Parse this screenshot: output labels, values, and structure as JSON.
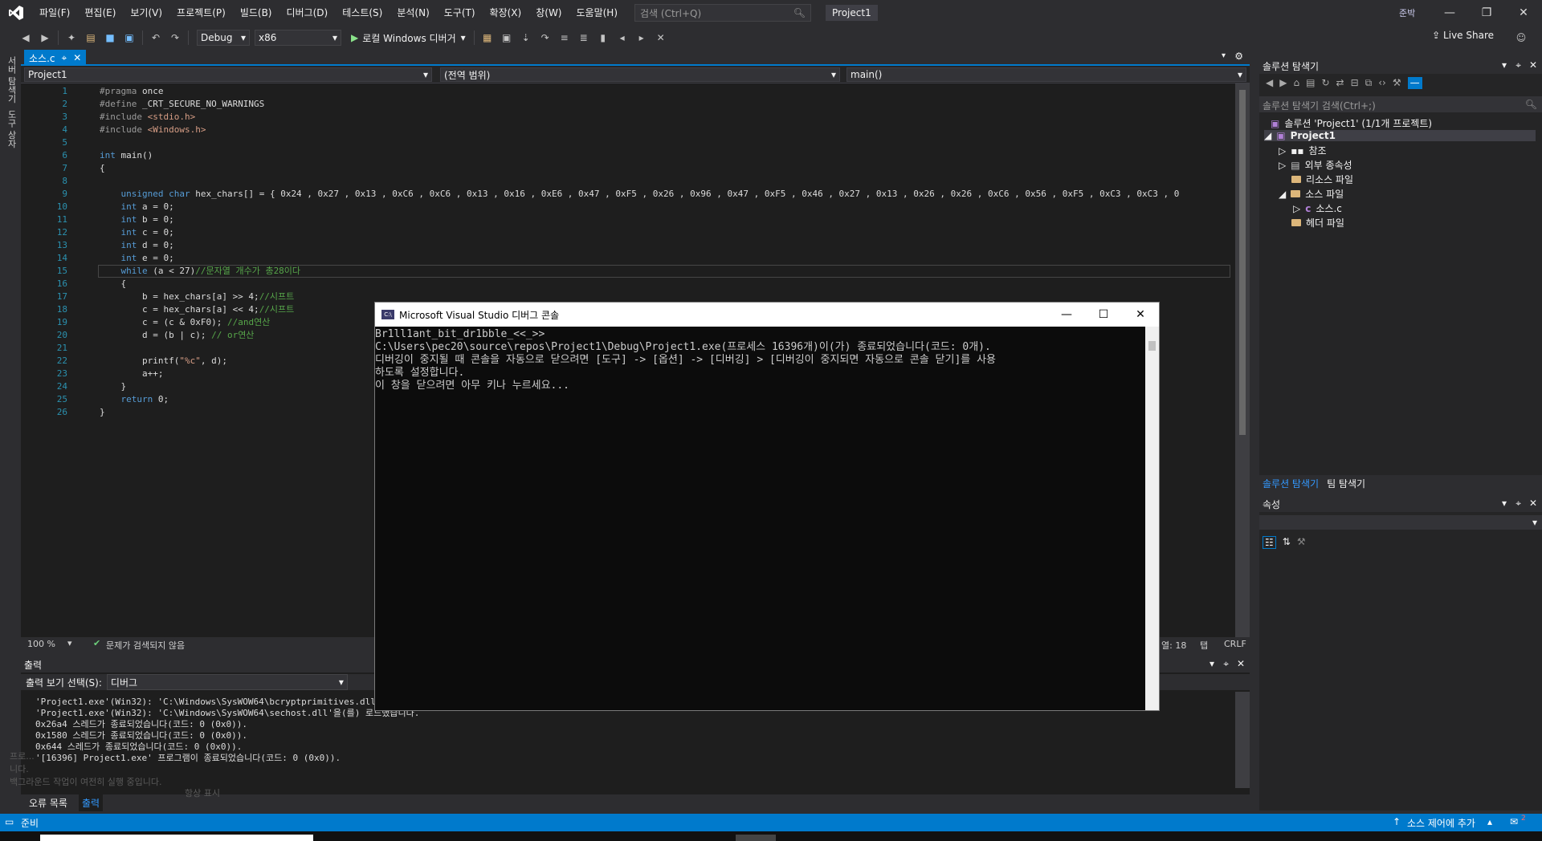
{
  "menubar": {
    "items": [
      "파일(F)",
      "편집(E)",
      "보기(V)",
      "프로젝트(P)",
      "빌드(B)",
      "디버그(D)",
      "테스트(S)",
      "분석(N)",
      "도구(T)",
      "확장(X)",
      "창(W)",
      "도움말(H)"
    ],
    "search_placeholder": "검색 (Ctrl+Q)",
    "project_name": "Project1",
    "avatar_initials": "준박"
  },
  "toolbar": {
    "config": "Debug",
    "platform": "x86",
    "run_label": "로컬 Windows 디버거",
    "live_share": "Live Share"
  },
  "left_tabs": [
    "서버 탐색기",
    "도구 상자"
  ],
  "editor": {
    "tab_label": "소스.c",
    "nav_project": "Project1",
    "nav_scope": "(전역 범위)",
    "nav_function": "main()",
    "zoom": "100 %",
    "issues": "문제가 검색되지 않음",
    "col": "열: 18",
    "tab_mode": "탭",
    "eol": "CRLF",
    "lines": [
      "#pragma once",
      "#define _CRT_SECURE_NO_WARNINGS",
      "#include <stdio.h>",
      "#include <Windows.h>",
      "",
      "int main()",
      "{",
      "",
      "    unsigned char hex_chars[] = { 0x24 , 0x27 , 0x13 , 0xC6 , 0xC6 , 0x13 , 0x16 , 0xE6 , 0x47 , 0xF5 , 0x26 , 0x96 , 0x47 , 0xF5 , 0x46 , 0x27 , 0x13 , 0x26 , 0x26 , 0xC6 , 0x56 , 0xF5 , 0xC3 , 0xC3 , 0",
      "    int a = 0;",
      "    int b = 0;",
      "    int c = 0;",
      "    int d = 0;",
      "    int e = 0;",
      "    while (a < 27)//문자열 개수가 총28이다",
      "    {",
      "        b = hex_chars[a] >> 4;//시프트",
      "        c = hex_chars[a] << 4;//시프트",
      "        c = (c & 0xF0); //and연산",
      "        d = (b | c); // or연산",
      "",
      "        printf(\"%c\", d);",
      "        a++;",
      "    }",
      "    return 0;",
      "}"
    ]
  },
  "solution_explorer": {
    "title": "솔루션 탐색기",
    "search_placeholder": "솔루션 탐색기 검색(Ctrl+;)",
    "solution": "솔루션 'Project1' (1/1개 프로젝트)",
    "project": "Project1",
    "items": [
      "참조",
      "외부 종속성",
      "리소스 파일",
      "소스 파일",
      "소스.c",
      "헤더 파일"
    ],
    "bottom_tabs": [
      "솔루션 탐색기",
      "팀 탐색기"
    ]
  },
  "properties": {
    "title": "속성"
  },
  "output": {
    "title": "출력",
    "source_label": "출력 보기 선택(S):",
    "source_value": "디버그",
    "lines": [
      "'Project1.exe'(Win32): 'C:\\Windows\\SysWOW64\\bcryptprimitives.dll'을(를) 로드했습니다.",
      "'Project1.exe'(Win32): 'C:\\Windows\\SysWOW64\\sechost.dll'을(를) 로드했습니다.",
      "0x26a4 스레드가 종료되었습니다(코드: 0 (0x0)).",
      "0x1580 스레드가 종료되었습니다(코드: 0 (0x0)).",
      "0x644 스레드가 종료되었습니다(코드: 0 (0x0)).",
      "'[16396] Project1.exe' 프로그램이 종료되었습니다(코드: 0 (0x0))."
    ],
    "tabs": [
      "오류 목록",
      "출력"
    ]
  },
  "statusbar": {
    "ready": "준비",
    "source_control": "소스 제어에 추가",
    "notifications": "2"
  },
  "console": {
    "title": "Microsoft Visual Studio 디버그 콘솔",
    "icon_text": "C:\\",
    "lines": [
      "Br1ll1ant_bit_dr1bble_<<_>>",
      "C:\\Users\\pec20\\source\\repos\\Project1\\Debug\\Project1.exe(프로세스 16396개)이(가) 종료되었습니다(코드: 0개).",
      "디버깅이 중지될 때 콘솔을 자동으로 닫으려면 [도구] -> [옵션] -> [디버깅] > [디버깅이 중지되면 자동으로 콘솔 닫기]를 사용",
      "하도록 설정합니다.",
      "이 창을 닫으려면 아무 키나 누르세요..."
    ]
  },
  "ghost_text": {
    "line1": "프로...",
    "line2": "니다.",
    "line3": "백그라운드 작업이 여전히 실행 중입니다.",
    "link": "항상 표시"
  },
  "colors": {
    "accent": "#007acc",
    "background": "#2d2d30",
    "editor_bg": "#1e1e1e"
  }
}
